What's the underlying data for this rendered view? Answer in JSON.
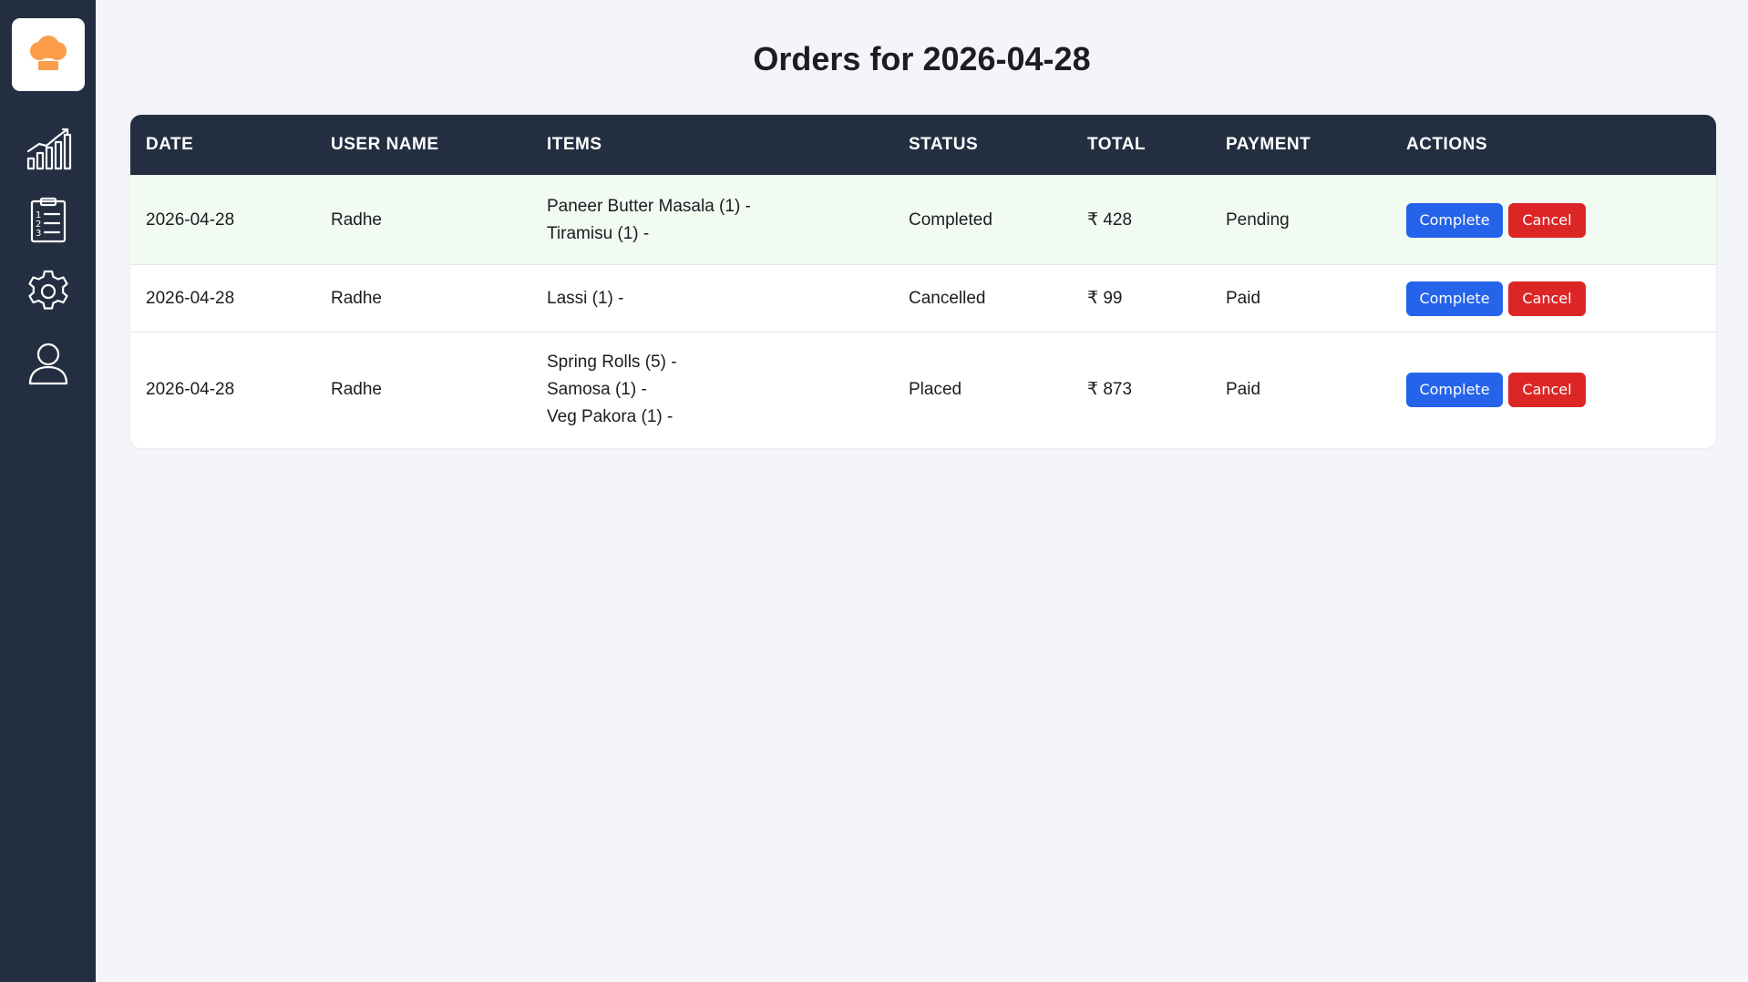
{
  "sidebar": {
    "items": [
      {
        "icon": "analytics-icon"
      },
      {
        "icon": "order-list-icon"
      },
      {
        "icon": "settings-gear-icon"
      },
      {
        "icon": "user-profile-icon"
      }
    ]
  },
  "page": {
    "title": "Orders for 2026-04-28"
  },
  "table": {
    "columns": [
      "DATE",
      "USER NAME",
      "ITEMS",
      "STATUS",
      "TOTAL",
      "PAYMENT",
      "ACTIONS"
    ],
    "rows": [
      {
        "date": "2026-04-28",
        "user": "Radhe",
        "items": [
          "Paneer Butter Masala (1) -",
          "Tiramisu (1) -"
        ],
        "status": "Completed",
        "total": "₹ 428",
        "payment": "Pending",
        "complete_label": "Complete",
        "cancel_label": "Cancel"
      },
      {
        "date": "2026-04-28",
        "user": "Radhe",
        "items": [
          "Lassi (1) -"
        ],
        "status": "Cancelled",
        "total": "₹ 99",
        "payment": "Paid",
        "complete_label": "Complete",
        "cancel_label": "Cancel"
      },
      {
        "date": "2026-04-28",
        "user": "Radhe",
        "items": [
          "Spring Rolls (5) -",
          "Samosa (1) -",
          "Veg Pakora (1) -"
        ],
        "status": "Placed",
        "total": "₹ 873",
        "payment": "Paid",
        "complete_label": "Complete",
        "cancel_label": "Cancel"
      }
    ]
  },
  "colors": {
    "sidebar_bg": "#232f41",
    "page_bg": "#f3f5f8",
    "highlight_row": "#f1fbf1",
    "complete_button": "#2563eb",
    "cancel_button": "#dc2626",
    "logo_orange": "#fb9d4b"
  }
}
